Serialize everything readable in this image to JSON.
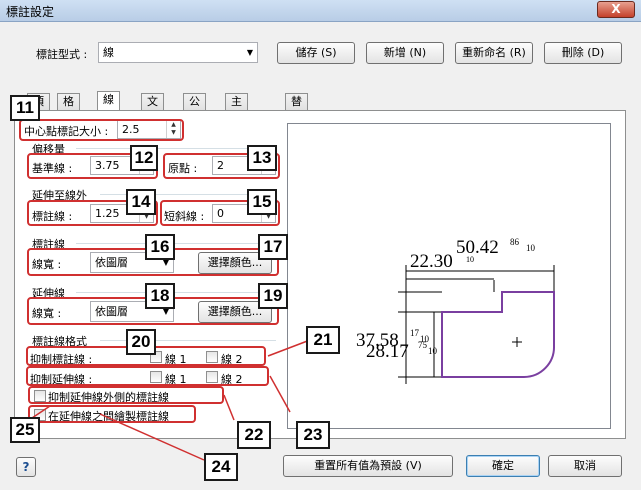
{
  "window": {
    "title": "標註設定",
    "close_label": "X"
  },
  "style": {
    "label": "標註型式 :",
    "value": "線"
  },
  "toolbar": {
    "save": "儲存 (S)",
    "new": "新增 (N)",
    "rename": "重新命名 (R)",
    "delete": "刪除 (D)"
  },
  "tabs": [
    "項",
    "格式",
    "線",
    "文字",
    "公差",
    "主要單位",
    "替用單位"
  ],
  "center_mark": {
    "label": "中心點標記大小 :",
    "value": "2.5"
  },
  "offset": {
    "title": "偏移量",
    "baseline_label": "基準線 :",
    "baseline_value": "3.75",
    "origin_label": "原點 :",
    "origin_value": "2"
  },
  "extend": {
    "title": "延伸至線外",
    "dimline_label": "標註線 :",
    "dimline_value": "1.25",
    "oblique_label": "短斜線 :",
    "oblique_value": "0"
  },
  "dimline": {
    "title": "標註線",
    "width_label": "線寬 :",
    "width_value": "依圖層",
    "color_button": "選擇顏色..."
  },
  "extline": {
    "title": "延伸線",
    "width_label": "線寬 :",
    "width_value": "依圖層",
    "color_button": "選擇顏色..."
  },
  "dimline_format": {
    "title": "標註線格式",
    "suppress_dim_label": "抑制標註線 :",
    "suppress_ext_label": "抑制延伸線 :",
    "line1": "線 1",
    "line2": "線 2",
    "suppress_outside": "抑制延伸線外側的標註線",
    "draw_between": "在延伸線之間繪製標註線"
  },
  "callouts": [
    "11",
    "12",
    "13",
    "14",
    "15",
    "16",
    "17",
    "18",
    "19",
    "20",
    "21",
    "22",
    "23",
    "24",
    "25"
  ],
  "preview": {
    "dim_top_left": "22.30",
    "dim_top_right": "50.42",
    "dim_top_tol": "86",
    "dim_top_tol2": "10",
    "dim_top_tol3": "10",
    "dim_left_a": "37.58",
    "dim_left_b": "28.17",
    "dim_left_tol_a": "17",
    "dim_left_tol_b": "10",
    "dim_left_tol_c": "75",
    "dim_left_tol_d": "10",
    "shape_color": "#7a3fa0"
  },
  "footer": {
    "help": "?",
    "reset": "重置所有值為預設 (V)",
    "ok": "確定",
    "cancel": "取消"
  },
  "colors": {
    "callout_border": "#d03030"
  }
}
